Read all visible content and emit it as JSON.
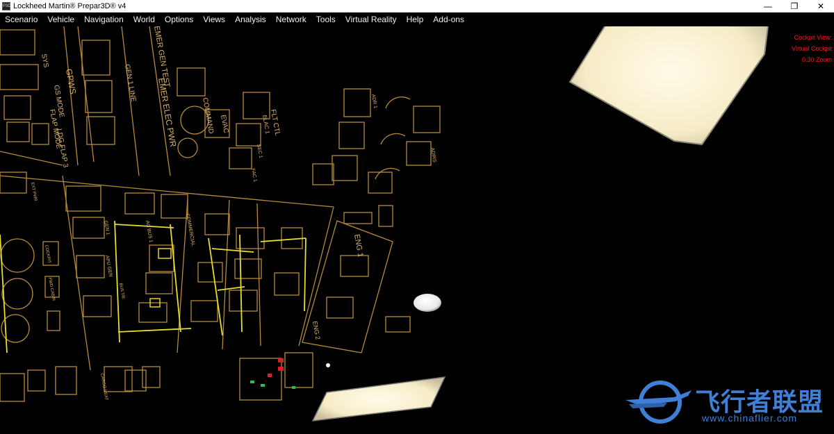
{
  "window": {
    "title": "Lockheed Martin® Prepar3D® v4",
    "app_icon_text": "P3D",
    "controls": {
      "minimize": "—",
      "restore": "❐",
      "close": "✕"
    }
  },
  "menu": [
    {
      "label": "Scenario"
    },
    {
      "label": "Vehicle"
    },
    {
      "label": "Navigation"
    },
    {
      "label": "World"
    },
    {
      "label": "Options"
    },
    {
      "label": "Views"
    },
    {
      "label": "Analysis"
    },
    {
      "label": "Network"
    },
    {
      "label": "Tools"
    },
    {
      "label": "Virtual Reality"
    },
    {
      "label": "Help"
    },
    {
      "label": "Add-ons"
    }
  ],
  "overlay": {
    "line1": "Cockpit View:",
    "line2": "Virtual Cockpit",
    "line3": "0.30 Zoom"
  },
  "panel_labels": {
    "sys": "SYS",
    "gpws": "GPWS",
    "gs_mode": "GS MODE",
    "flap_mode": "FLAP MODE",
    "ldg_flap3": "LDG FLAP 3",
    "gen1_line": "GEN 1 LINE",
    "emer_gen_test": "EMER GEN TEST",
    "emer_elec_pwr": "EMER ELEC PWR",
    "command": "COMMAND",
    "evac": "EVAC",
    "flt_ctl": "FLT CTL",
    "elac": "ELAC 1",
    "sec1": "SEC 1",
    "fac1": "FAC 1",
    "adirs": "ADIRS",
    "adr1": "ADR 1",
    "commercial": "COMMERCIAL",
    "gen1": "GEN 1",
    "apu_gen": "APU GEN",
    "ac_bus1": "AC BUS 1",
    "bus_tie": "BUS TIE",
    "eng1": "ENG 1",
    "eng2": "ENG 2",
    "cockpit": "COCKPIT",
    "fwd_cabin": "FWD CABIN",
    "cargo_heat": "CARGO HEAT",
    "ext_pwr": "EXT PWR"
  },
  "watermark": {
    "cn": "飞行者联盟",
    "url": "www.chinaflier.com"
  },
  "colors": {
    "panel_line": "#b88a3c",
    "panel_text": "#d9b36a",
    "lit_yellow": "#e6e02a",
    "overlay_red": "#ff1a1a",
    "watermark_blue": "#3f7fd6",
    "light_cream": "#fbf2d2"
  }
}
